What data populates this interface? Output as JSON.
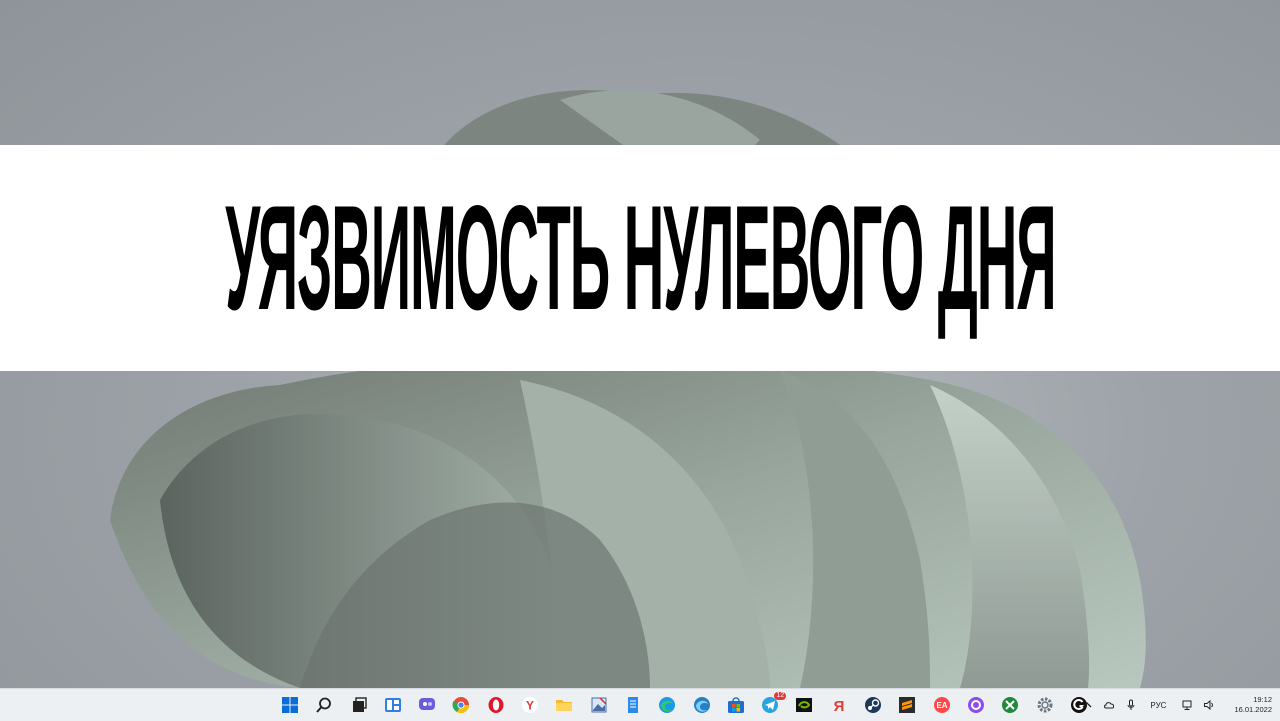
{
  "headline": "УЯЗВИМОСТЬ НУЛЕВОГО ДНЯ",
  "taskbar": {
    "apps": [
      {
        "name": "start-button",
        "icon": "windows-icon"
      },
      {
        "name": "search-button",
        "icon": "search-icon"
      },
      {
        "name": "task-view-button",
        "icon": "task-view-icon"
      },
      {
        "name": "widgets-button",
        "icon": "widgets-icon"
      },
      {
        "name": "chat-button",
        "icon": "chat-icon"
      },
      {
        "name": "chrome-button",
        "icon": "chrome-icon"
      },
      {
        "name": "opera-button",
        "icon": "opera-icon"
      },
      {
        "name": "yandex-browser-button",
        "icon": "yandex-browser-icon"
      },
      {
        "name": "file-explorer-button",
        "icon": "folder-icon"
      },
      {
        "name": "image-editor-button",
        "icon": "image-editor-icon"
      },
      {
        "name": "notepad-button",
        "icon": "notepad-icon"
      },
      {
        "name": "edge-button",
        "icon": "edge-icon"
      },
      {
        "name": "edge-dev-button",
        "icon": "edge-dev-icon"
      },
      {
        "name": "store-button",
        "icon": "store-icon"
      },
      {
        "name": "telegram-button",
        "icon": "telegram-icon",
        "badge": "12"
      },
      {
        "name": "nvidia-button",
        "icon": "nvidia-icon"
      },
      {
        "name": "yandex-button",
        "icon": "yandex-icon"
      },
      {
        "name": "steam-button",
        "icon": "steam-icon"
      },
      {
        "name": "sublime-button",
        "icon": "sublime-icon"
      },
      {
        "name": "ea-button",
        "icon": "ea-icon"
      },
      {
        "name": "alice-button",
        "icon": "alice-icon"
      },
      {
        "name": "xbox-button",
        "icon": "xbox-icon"
      },
      {
        "name": "settings-button",
        "icon": "gear-icon"
      },
      {
        "name": "g-app-button",
        "icon": "g-app-icon"
      }
    ],
    "tray": {
      "language": "РУС",
      "time": "19:12",
      "date": "16.01.2022"
    }
  },
  "colors": {
    "banner": "#ffffff",
    "headline": "#000000",
    "taskbar": "#edf0f3"
  }
}
